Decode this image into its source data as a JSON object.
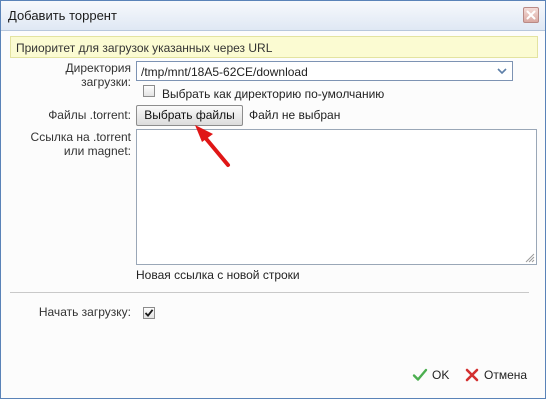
{
  "dialog": {
    "title": "Добавить торрент"
  },
  "notice": {
    "text": "Приоритет для загрузок указанных через URL"
  },
  "download_dir": {
    "label": "Директория\nзагрузки:",
    "value": "/tmp/mnt/18A5-62CE/download"
  },
  "default_dir_checkbox": {
    "label": "Выбрать как директорию по-умолчанию",
    "checked": false
  },
  "torrent_files": {
    "label": "Файлы .torrent:",
    "button_label": "Выбрать файлы",
    "status": "Файл не выбран"
  },
  "link": {
    "label": "Ссылка на .torrent\nили magnet:",
    "value": "",
    "hint": "Новая ссылка с новой строки"
  },
  "start_download": {
    "label": "Начать загрузку:",
    "checked": true
  },
  "footer": {
    "ok_label": "OK",
    "cancel_label": "Отмена"
  },
  "colors": {
    "notice_bg": "#fbfbd2",
    "ok_icon": "#4caf50",
    "cancel_icon": "#d32f2f",
    "annotation_arrow": "#e01616"
  }
}
